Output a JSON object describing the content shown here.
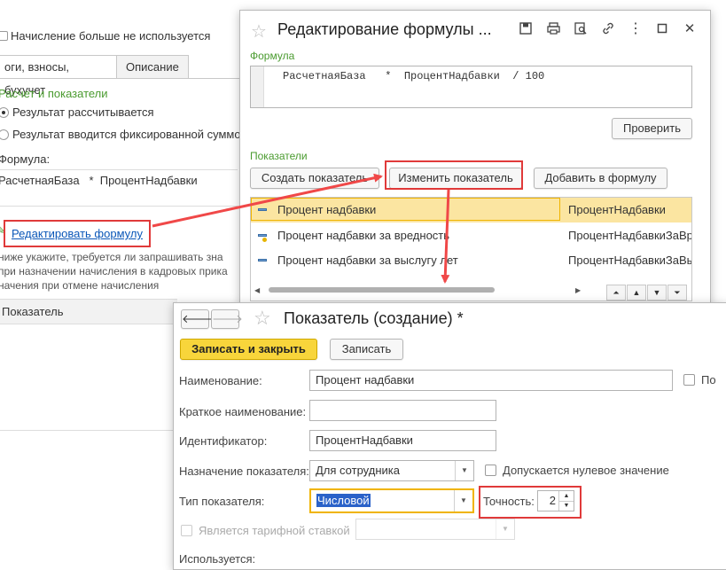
{
  "background_form": {
    "unused_checkbox_label": "Начисление больше не используется",
    "tabs": [
      "оги, взносы, бухучет",
      "Описание"
    ],
    "section_title": "Расчет и показатели",
    "radio_calculated": "Результат рассчитывается",
    "radio_fixed": "Результат вводится фиксированной суммо",
    "formula_label": "Формула:",
    "formula_text": "РасчетнаяБаза   *  ПроцентНадбавки",
    "edit_formula_link": "Редактировать формулу",
    "hint_line1": "ниже укажите, требуется ли запрашивать зна",
    "hint_line2": "при назначении начисления в кадровых прика",
    "hint_line3": "начения при отмене начисления",
    "column_indicator": "Показатель"
  },
  "formula_window": {
    "title": "Редактирование формулы ...",
    "formula_label": "Формула",
    "formula_value": "РасчетнаяБаза   *  ПроцентНадбавки  / 100",
    "check_button": "Проверить",
    "indicators_label": "Показатели",
    "create_button": "Создать показатель",
    "edit_button": "Изменить показатель",
    "add_button": "Добавить в формулу",
    "rows": [
      {
        "name": "Процент надбавки",
        "id": "ПроцентНадбавки"
      },
      {
        "name": "Процент надбавки за вредность",
        "id": "ПроцентНадбавкиЗаВре"
      },
      {
        "name": "Процент надбавки за выслугу лет",
        "id": "ПроцентНадбавкиЗаВы"
      }
    ]
  },
  "indicator_window": {
    "title": "Показатель (создание) *",
    "save_close_button": "Записать и закрыть",
    "save_button": "Записать",
    "name_label": "Наименование:",
    "name_value": "Процент надбавки",
    "right_checkbox_label": "По",
    "short_name_label": "Краткое наименование:",
    "short_name_value": "",
    "identifier_label": "Идентификатор:",
    "identifier_value": "ПроцентНадбавки",
    "purpose_label": "Назначение показателя:",
    "purpose_value": "Для сотрудника",
    "zero_allowed_label": "Допускается нулевое значение",
    "type_label": "Тип показателя:",
    "type_value": "Числовой",
    "precision_label": "Точность:",
    "precision_value": "2",
    "tariff_label": "Является тарифной ставкой",
    "used_label": "Используется:"
  }
}
